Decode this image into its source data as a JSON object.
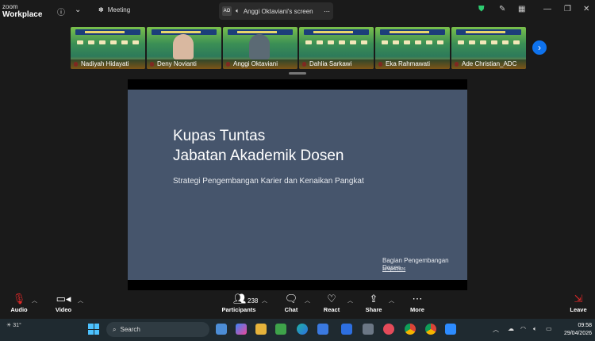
{
  "app": {
    "logo_line1": "zoom",
    "logo_line2": "Workplace",
    "meeting_label": "Meeting"
  },
  "share_banner": {
    "initials": "AO",
    "label": "Anggi Oktaviani's screen"
  },
  "participants": [
    {
      "name": "Nadiyah Hidayati"
    },
    {
      "name": "Deny Novianti"
    },
    {
      "name": "Anggi Oktaviani"
    },
    {
      "name": "Dahlia Sarkawi"
    },
    {
      "name": "Eka Rahmawati"
    },
    {
      "name": "Ade Christian_ADC"
    }
  ],
  "slide": {
    "title_line1": "Kupas Tuntas",
    "title_line2": "Jabatan Akademik Dosen",
    "subtitle": "Strategi Pengembangan Karier dan Kenaikan Pangkat",
    "footer": "Bagian Pengembangan Dosen",
    "date": "29 April 2026"
  },
  "toolbar": {
    "audio": "Audio",
    "video": "Video",
    "participants": "Participants",
    "participants_count": "238",
    "chat": "Chat",
    "react": "React",
    "share": "Share",
    "more": "More",
    "leave": "Leave"
  },
  "taskbar": {
    "weather": "31°",
    "search_placeholder": "Search",
    "time": "09:58",
    "date": "29/04/2026"
  },
  "colors": {
    "accent": "#0e72ed",
    "leave": "#e02828",
    "slide_bg": "#46556c"
  }
}
